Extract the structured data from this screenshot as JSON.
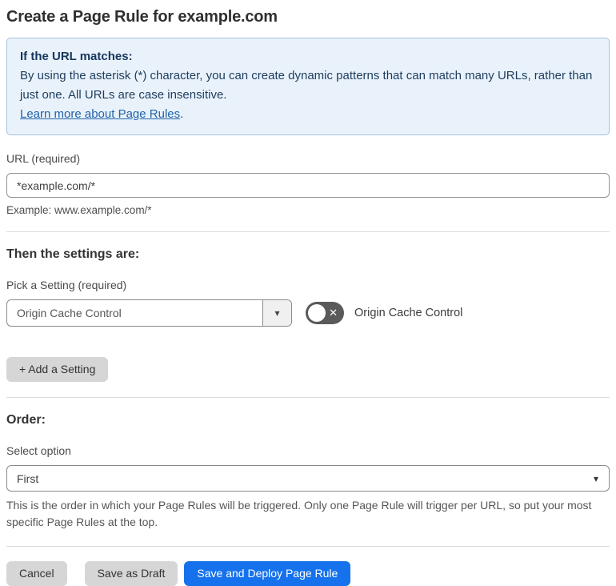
{
  "page_title": "Create a Page Rule for example.com",
  "info_box": {
    "heading": "If the URL matches:",
    "body": "By using the asterisk (*) character, you can create dynamic patterns that can match many URLs, rather than just one. All URLs are case insensitive.",
    "link_text": "Learn more about Page Rules",
    "link_suffix": "."
  },
  "url_field": {
    "label": "URL (required)",
    "value": "*example.com/*",
    "example": "Example: www.example.com/*"
  },
  "settings_section": {
    "heading": "Then the settings are:",
    "pick_label": "Pick a Setting (required)",
    "selected_setting": "Origin Cache Control",
    "dropdown_caret": "▾",
    "toggle_state": "off",
    "toggle_off_glyph": "✕",
    "toggle_label": "Origin Cache Control",
    "add_setting_button": "+ Add a Setting"
  },
  "order_section": {
    "heading": "Order:",
    "select_label": "Select option",
    "selected_option": "First",
    "dropdown_caret": "▾",
    "help_text": "This is the order in which your Page Rules will be triggered. Only one Page Rule will trigger per URL, so put your most specific Page Rules at the top."
  },
  "footer": {
    "cancel_label": "Cancel",
    "save_draft_label": "Save as Draft",
    "deploy_label": "Save and Deploy Page Rule"
  },
  "colors": {
    "accent_blue": "#1672ec",
    "info_background": "#e9f2fb",
    "info_border": "#a4c4dd",
    "info_text": "#1d3d5e",
    "link_blue": "#2262a9",
    "toggle_off_background": "#5a5a5a",
    "button_gray": "#d6d6d6"
  }
}
